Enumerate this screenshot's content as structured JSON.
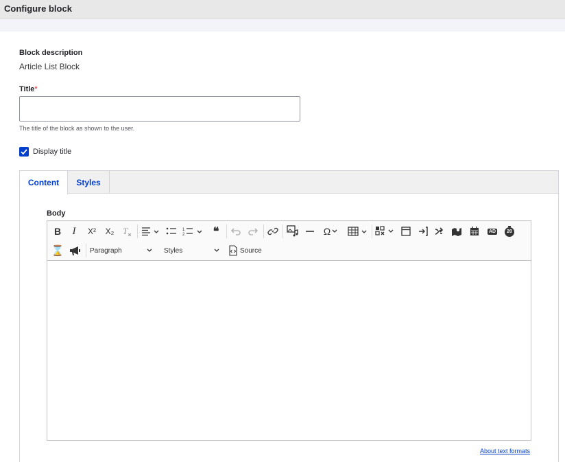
{
  "dialog": {
    "title": "Configure block"
  },
  "block": {
    "description_label": "Block description",
    "description_value": "Article List Block"
  },
  "title_field": {
    "label": "Title",
    "required_mark": "*",
    "value": "",
    "help": "The title of the block as shown to the user."
  },
  "display_title": {
    "label": "Display title",
    "checked": true
  },
  "tabs": [
    {
      "label": "Content",
      "active": true
    },
    {
      "label": "Styles",
      "active": false
    }
  ],
  "body": {
    "label": "Body",
    "heading_select": "Paragraph",
    "styles_select": "Styles",
    "source_label": "Source",
    "superscript_label": "X²",
    "subscript_label": "X₂",
    "special_char": "Ω",
    "ad_badge": "AD",
    "timer_badge": "20",
    "quote_glyph": "❝",
    "hourglass_glyph": "⌛"
  },
  "footer": {
    "about_link": "About text formats"
  },
  "colors": {
    "accent": "#003ecc",
    "required": "#dc2323"
  }
}
